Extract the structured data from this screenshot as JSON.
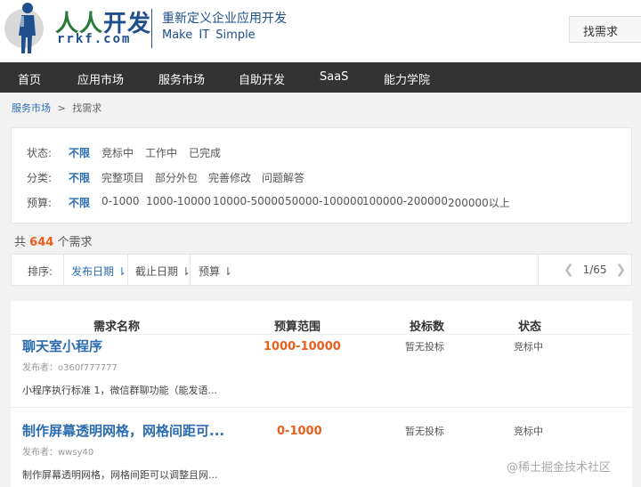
{
  "header": {
    "logo_part1": "人人",
    "logo_part2": "开发",
    "logo_domain": "rrkf.com",
    "slogan_cn": "重新定义企业应用开发",
    "slogan_en": "Make IT Simple",
    "find_button": "找需求"
  },
  "nav": {
    "items": [
      "首页",
      "应用市场",
      "服务市场",
      "自助开发",
      "SaaS",
      "能力学院"
    ]
  },
  "breadcrumb": {
    "parent": "服务市场",
    "separator": ">",
    "current": "找需求"
  },
  "filters": {
    "status": {
      "label": "状态:",
      "options": [
        "不限",
        "竞标中",
        "工作中",
        "已完成"
      ],
      "selected": "不限"
    },
    "category": {
      "label": "分类:",
      "options": [
        "不限",
        "完整项目",
        "部分外包",
        "完善修改",
        "问题解答"
      ],
      "selected": "不限"
    },
    "budget": {
      "label": "预算:",
      "options": [
        "不限",
        "0-1000",
        "1000-10000",
        "10000-50000",
        "50000-100000",
        "100000-200000",
        "200000以上"
      ],
      "selected": "不限"
    }
  },
  "count": {
    "prefix": "共",
    "value": "644",
    "suffix": "个需求"
  },
  "sort": {
    "label": "排序:",
    "options": [
      "发布日期 ⇂",
      "截止日期 ⇂",
      "预算 ⇂"
    ],
    "active": "发布日期 ⇂",
    "page_indicator": "1/65"
  },
  "list": {
    "headers": [
      "需求名称",
      "预算范围",
      "投标数",
      "状态"
    ],
    "items": [
      {
        "title": "聊天室小程序",
        "budget": "1000-10000",
        "bids": "暂无投标",
        "status": "竞标中",
        "publisher": "发布者：o360f777777",
        "desc": "小程序执行标准 1，微信群聊功能（能发语..."
      },
      {
        "title": "制作屏幕透明网格，网格间距可...",
        "budget": "0-1000",
        "bids": "暂无投标",
        "status": "竞标中",
        "publisher": "发布者：wwsy40",
        "desc": "制作屏幕透明网格，网格间距可以调整且网..."
      }
    ]
  },
  "watermark": "@稀土掘金技术社区",
  "colors": {
    "nav_bg": "#333333",
    "link_blue": "#2b6cb0",
    "accent_orange": "#e8601c",
    "brand_green": "#2a7a3b",
    "brand_blue": "#1f4f8c"
  },
  "icons": {
    "logo": "person-figure-icon",
    "prev": "chevron-left-icon",
    "next": "chevron-right-icon"
  }
}
